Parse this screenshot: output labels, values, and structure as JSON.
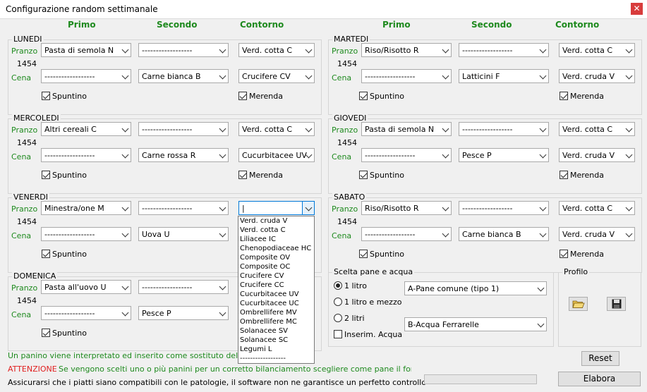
{
  "window": {
    "title": "Configurazione random settimanale",
    "close": "✕"
  },
  "col_headers": {
    "primo": "Primo",
    "secondo": "Secondo",
    "contorno": "Contorno"
  },
  "labels": {
    "pranzo": "Pranzo",
    "cena": "Cena",
    "spuntino": "Spuntino",
    "merenda": "Merenda"
  },
  "days": {
    "lunedi": {
      "name": "LUNEDI",
      "kcal": "1454",
      "pranzo": {
        "primo": "Pasta di semola  N",
        "secondo": "------------------",
        "contorno": "Verd. cotta C"
      },
      "cena": {
        "primo": "------------------",
        "secondo": "Carne bianca B",
        "contorno": "Crucifere CV"
      },
      "spuntino": true,
      "merenda": true
    },
    "martedi": {
      "name": "MARTEDI",
      "kcal": "1454",
      "pranzo": {
        "primo": "Riso/Risotto  R",
        "secondo": "------------------",
        "contorno": "Verd. cotta C"
      },
      "cena": {
        "primo": "------------------",
        "secondo": "Latticini F",
        "contorno": "Verd. cruda V"
      },
      "spuntino": true,
      "merenda": true
    },
    "mercoledi": {
      "name": "MERCOLEDI",
      "kcal": "1454",
      "pranzo": {
        "primo": "Altri cereali  C",
        "secondo": "------------------",
        "contorno": "Verd. cotta C"
      },
      "cena": {
        "primo": "------------------",
        "secondo": "Carne rossa R",
        "contorno": "Cucurbitacee UV"
      },
      "spuntino": true,
      "merenda": true
    },
    "giovedi": {
      "name": "GIOVEDI",
      "kcal": "1454",
      "pranzo": {
        "primo": "Pasta di semola  N",
        "secondo": "------------------",
        "contorno": "Verd. cotta C"
      },
      "cena": {
        "primo": "------------------",
        "secondo": "Pesce P",
        "contorno": "Verd. cruda V"
      },
      "spuntino": true,
      "merenda": true
    },
    "venerdi": {
      "name": "VENERDI",
      "kcal": "1454",
      "pranzo": {
        "primo": "Minestra/one  M",
        "secondo": "------------------",
        "contorno": "|"
      },
      "cena": {
        "primo": "------------------",
        "secondo": "Uova U",
        "contorno": ""
      },
      "spuntino": true,
      "merenda": false
    },
    "sabato": {
      "name": "SABATO",
      "kcal": "1454",
      "pranzo": {
        "primo": "Riso/Risotto  R",
        "secondo": "------------------",
        "contorno": "Verd. cotta C"
      },
      "cena": {
        "primo": "------------------",
        "secondo": "Carne bianca B",
        "contorno": "Verd. cruda V"
      },
      "spuntino": true,
      "merenda": true
    },
    "domenica": {
      "name": "DOMENICA",
      "kcal": "1454",
      "pranzo": {
        "primo": "Pasta all'uovo  U",
        "secondo": "------------------",
        "contorno": ""
      },
      "cena": {
        "primo": "------------------",
        "secondo": "Pesce P",
        "contorno": ""
      },
      "spuntino": true,
      "merenda": false
    }
  },
  "dropdown_options": [
    "Verd. cruda V",
    "Verd. cotta C",
    "Liliacee IC",
    "Chenopodiaceae HC",
    "Composite OV",
    "Composite OC",
    "Crucifere CV",
    "Crucifere CC",
    "Cucurbitacee UV",
    "Cucurbitacee UC",
    "Ombrellifere  MV",
    "Ombrellifere  MC",
    "Solanacee SV",
    "Solanacee SC",
    "Legumi L",
    "------------------"
  ],
  "pane_acqua": {
    "title": "Scelta pane e acqua",
    "options": [
      "1 litro",
      "1 litro e mezzo",
      "2 litri"
    ],
    "selected": 0,
    "pane": "A-Pane comune (tipo 1)",
    "acqua": "B-Acqua Ferrarelle",
    "inserim_label": "Inserim.  Acqua"
  },
  "profilo": {
    "title": "Profilo"
  },
  "footer": {
    "note1": "Un panino  viene interpretato ed inserito come sostituto dell'intero",
    "attenzione": "ATTENZIONE",
    "note2": "Se vengono scelti uno o più panini per un corretto bilanciamento scegliere come pane il formato rosett",
    "note3": "Assicurarsi che i piatti siano compatibili con le patologie, il software non ne  garantisce un perfetto controllo",
    "reset": "Reset",
    "elabora": "Elabora"
  },
  "colors": {
    "green": "#1e8a1e",
    "red": "#e02020"
  }
}
